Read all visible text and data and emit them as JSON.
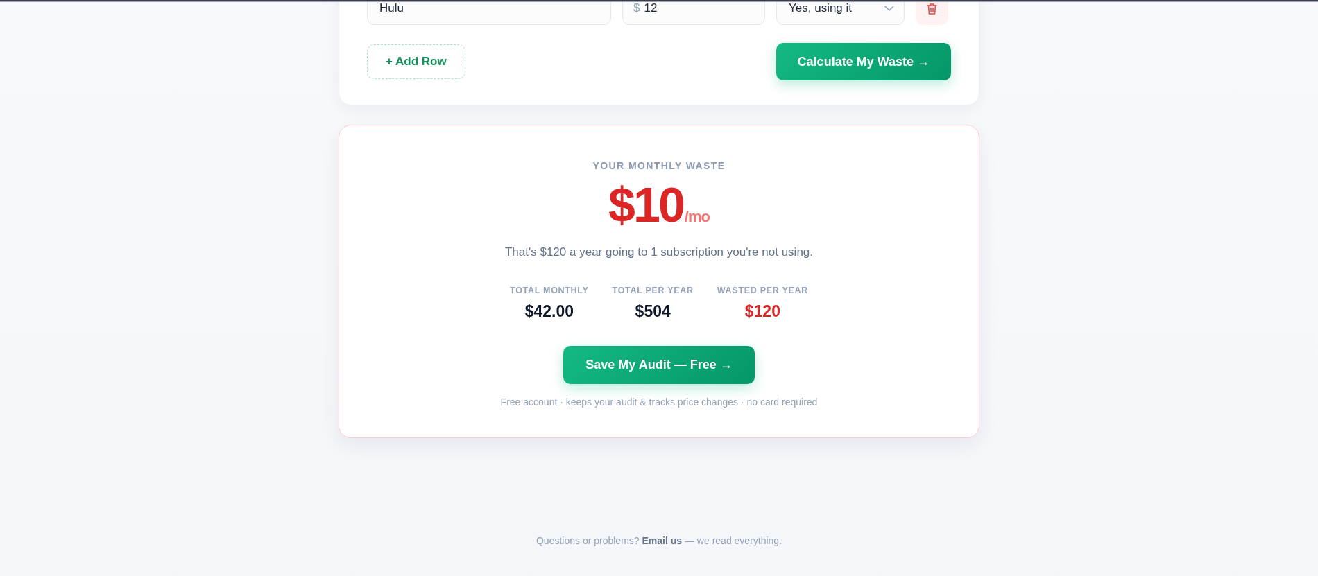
{
  "subscription_rows": [
    {
      "name": "Hulu",
      "currency": "$",
      "price": "12",
      "status": "Yes, using it"
    }
  ],
  "actions": {
    "add_row": "+ Add Row",
    "calculate": "Calculate My Waste →"
  },
  "result": {
    "eyebrow": "YOUR MONTHLY WASTE",
    "amount": "$10",
    "unit": "/mo",
    "summary": "That's $120 a year going to 1 subscription you're not using.",
    "stats": [
      {
        "label": "TOTAL MONTHLY",
        "value": "$42.00",
        "kind": "total"
      },
      {
        "label": "TOTAL PER YEAR",
        "value": "$504",
        "kind": "total"
      },
      {
        "label": "WASTED PER YEAR",
        "value": "$120",
        "kind": "waste"
      }
    ],
    "cta": "Save My Audit — Free →",
    "note": "Free account · keeps your audit & tracks price changes · no card required"
  },
  "footer": {
    "text_before": "Questions or problems?",
    "link": "Email us",
    "text_after": "— we read everything."
  }
}
